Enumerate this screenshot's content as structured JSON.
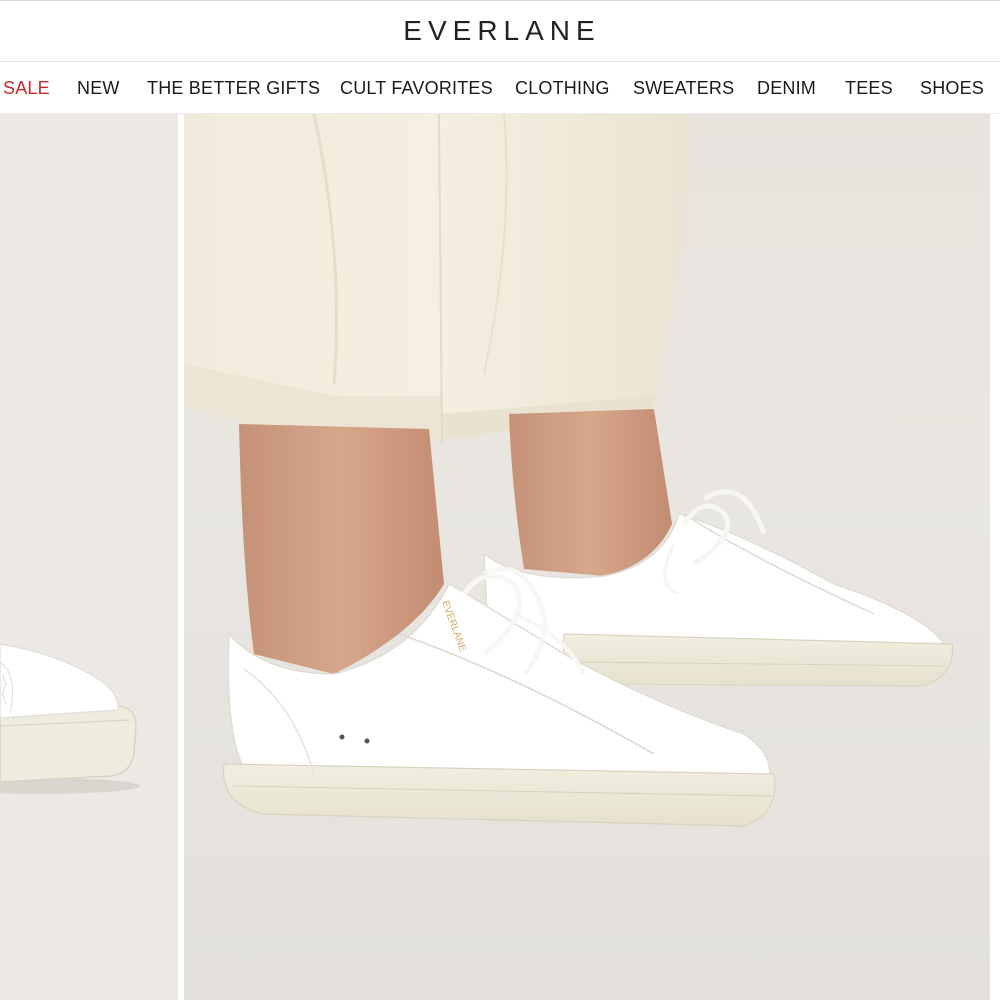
{
  "brand": {
    "logo_text": "EVERLANE"
  },
  "nav": {
    "items": [
      {
        "label": "SALE",
        "highlight": true
      },
      {
        "label": "NEW"
      },
      {
        "label": "THE BETTER GIFTS"
      },
      {
        "label": "CULT FAVORITES"
      },
      {
        "label": "CLOTHING"
      },
      {
        "label": "SWEATERS"
      },
      {
        "label": "DENIM"
      },
      {
        "label": "TEES"
      },
      {
        "label": "SHOES"
      }
    ]
  },
  "gallery": {
    "main_image": "model-wearing-white-leather-sneakers-and-cream-pants",
    "side_image": "white-leather-sneaker-side-view"
  },
  "colors": {
    "sale": "#c3292f",
    "text": "#1a1a1a",
    "background": "#e8e5e0"
  }
}
